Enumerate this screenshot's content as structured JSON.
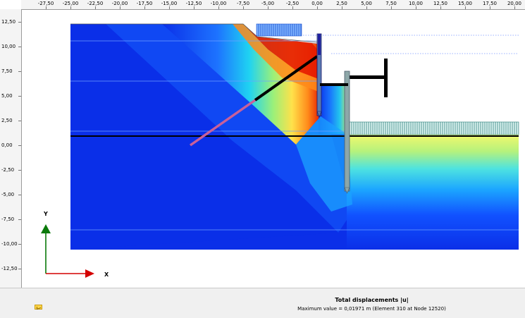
{
  "axes": {
    "x_ticks": [
      "-27,50",
      "-25,00",
      "-22,50",
      "-20,00",
      "-17,50",
      "-15,00",
      "-12,50",
      "-10,00",
      "-7,50",
      "-5,00",
      "-2,50",
      "0,00",
      "2,50",
      "5,00",
      "7,50",
      "10,00",
      "12,50",
      "15,00",
      "17,50",
      "20,00"
    ],
    "y_ticks": [
      "12,50",
      "10,00",
      "7,50",
      "5,00",
      "2,50",
      "0,00",
      "-2,50",
      "-5,00",
      "-7,50",
      "-10,00",
      "-12,50"
    ],
    "y_label": "Y",
    "x_label": "X"
  },
  "result": {
    "title": "Total displacements |u|",
    "max_value": "Maximum value = 0,01971 m (Element 310 at Node 12520)"
  },
  "colors": {
    "low": "#0b2fe8",
    "high": "#d60000",
    "anchor_grout": "#c9609a",
    "structure": "#000000"
  },
  "icons": {
    "message": "message-envelope-icon"
  }
}
